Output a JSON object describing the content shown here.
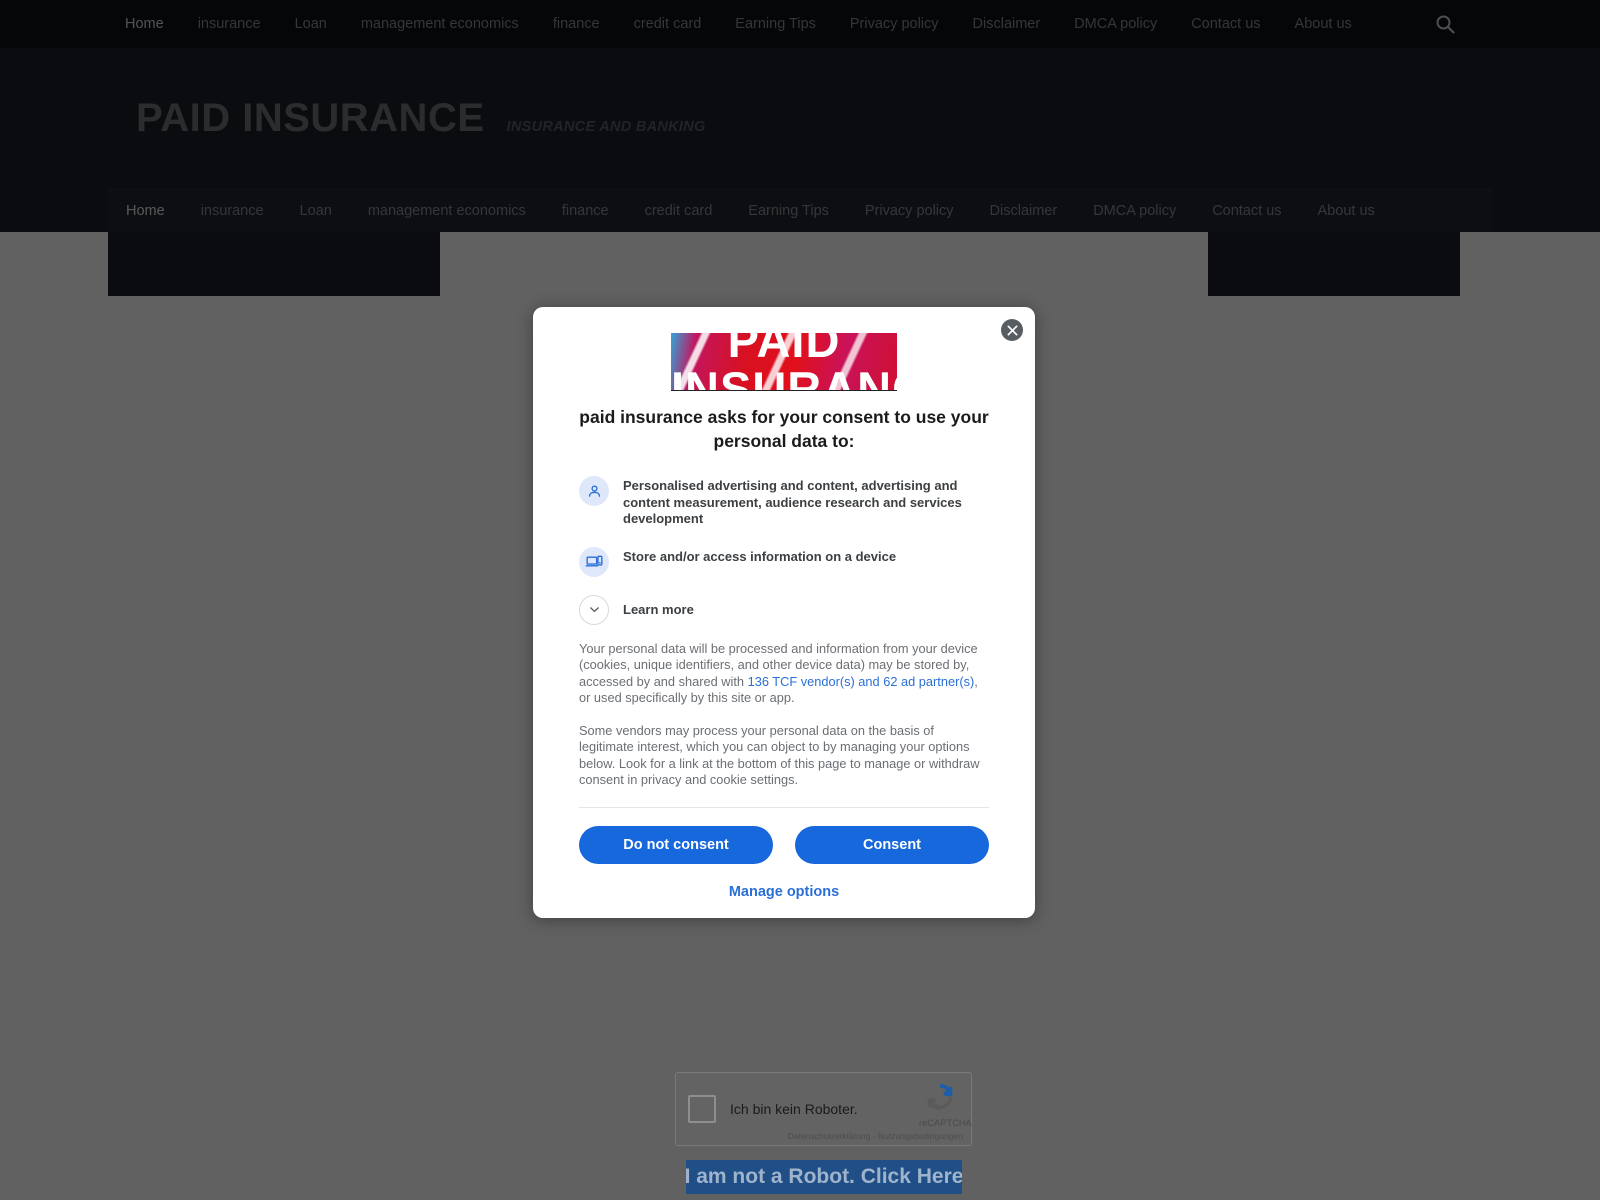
{
  "topbar": {
    "nav": [
      {
        "label": "Home",
        "active": true
      },
      {
        "label": "insurance",
        "active": false
      },
      {
        "label": "Loan",
        "active": false
      },
      {
        "label": "management economics",
        "active": false
      },
      {
        "label": "finance",
        "active": false
      },
      {
        "label": "credit card",
        "active": false
      },
      {
        "label": "Earning Tips",
        "active": false
      },
      {
        "label": "Privacy policy",
        "active": false
      },
      {
        "label": "Disclaimer",
        "active": false
      },
      {
        "label": "DMCA policy",
        "active": false
      },
      {
        "label": "Contact us",
        "active": false
      },
      {
        "label": "About us",
        "active": false
      }
    ],
    "search_icon": "search-icon"
  },
  "header": {
    "title": "PAID INSURANCE",
    "tagline": "INSURANCE AND BANKING"
  },
  "mainnav": {
    "items": [
      {
        "label": "Home",
        "active": true
      },
      {
        "label": "insurance",
        "active": false
      },
      {
        "label": "Loan",
        "active": false
      },
      {
        "label": "management economics",
        "active": false
      },
      {
        "label": "finance",
        "active": false
      },
      {
        "label": "credit card",
        "active": false
      },
      {
        "label": "Earning Tips",
        "active": false
      },
      {
        "label": "Privacy policy",
        "active": false
      },
      {
        "label": "Disclaimer",
        "active": false
      },
      {
        "label": "DMCA policy",
        "active": false
      },
      {
        "label": "Contact us",
        "active": false
      },
      {
        "label": "About us",
        "active": false
      }
    ]
  },
  "consent_modal": {
    "close_icon": "close-icon",
    "logo_line1": "PAID",
    "logo_line2": "INSURANC",
    "title": "paid insurance asks for your consent to use your personal data to:",
    "purposes": [
      {
        "icon": "person-icon",
        "text": "Personalised advertising and content, advertising and content measurement, audience research and services development"
      },
      {
        "icon": "device-icon",
        "text": "Store and/or access information on a device"
      }
    ],
    "learn_more": {
      "label": "Learn more",
      "icon": "chevron-down-icon"
    },
    "paragraph1_before": "Your personal data will be processed and information from your device (cookies, unique identifiers, and other device data) may be stored by, accessed by and shared with ",
    "paragraph1_link": "136 TCF vendor(s) and 62 ad partner(s)",
    "paragraph1_after": ", or used specifically by this site or app.",
    "paragraph2": "Some vendors may process your personal data on the basis of legitimate interest, which you can object to by managing your options below. Look for a link at the bottom of this page to manage or withdraw consent in privacy and cookie settings.",
    "do_not_consent_label": "Do not consent",
    "consent_label": "Consent",
    "manage_options_label": "Manage options",
    "accent_color": "#1668dc",
    "link_color": "#2b6fd6"
  },
  "recaptcha": {
    "checkbox_label": "Ich bin kein Roboter.",
    "brand": "reCAPTCHA",
    "fine_print": "Datenschutzerklärung - Nutzungsbedingungen",
    "logo_icon": "recaptcha-icon"
  },
  "robot_banner": {
    "text": "I am not a Robot. Click Here",
    "background_color": "#1f4f86"
  }
}
